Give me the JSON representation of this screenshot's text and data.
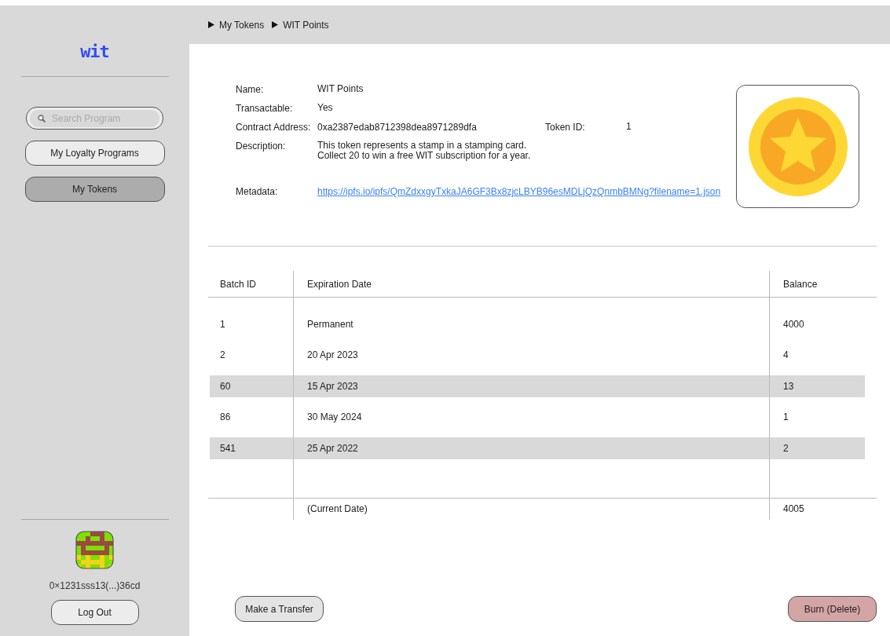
{
  "logo": "wit",
  "breadcrumb": [
    "My Tokens",
    "WIT Points"
  ],
  "sidebar": {
    "search": {
      "placeholder": "Search Program"
    },
    "items": [
      {
        "label": "My Loyalty Programs",
        "selected": false
      },
      {
        "label": "My Tokens",
        "selected": true
      }
    ],
    "account": {
      "address": "0×1231sss13(...)36cd",
      "logout": "Log Out"
    }
  },
  "token": {
    "fields": [
      {
        "label": "Name:",
        "value": "WIT Points"
      },
      {
        "label": "Transactable:",
        "value": "Yes"
      },
      {
        "label": "Contract Address:",
        "value": "0xa2387edab8712398dea8971289dfa",
        "extra_label": "Token ID:",
        "extra_value": "1"
      },
      {
        "label": "Description:",
        "value": "This token represents a stamp in a stamping card.\nCollect 20 to win a free WIT subscription for a year."
      }
    ],
    "metadata": {
      "label": "Metadata:",
      "link": "https://ipfs.io/ipfs/QmZdxxgyTxkaJA6GF3Bx8zjcLBYB96esMDLjQzQnmbBMNg?filename=1.json"
    }
  },
  "table": {
    "columns": [
      "Batch ID",
      "Expiration Date",
      "Balance"
    ],
    "rows": [
      {
        "cells": [
          "1",
          "Permanent",
          "4000"
        ],
        "highlighted": false
      },
      {
        "cells": [
          "2",
          "20 Apr 2023",
          "4"
        ],
        "highlighted": false
      },
      {
        "cells": [
          "60",
          "15 Apr 2023",
          "13"
        ],
        "highlighted": true
      },
      {
        "cells": [
          "86",
          "30 May 2024",
          "1"
        ],
        "highlighted": false
      },
      {
        "cells": [
          "541",
          "25 Apr 2022",
          "2"
        ],
        "highlighted": true
      }
    ],
    "footer": [
      "(Current Date)",
      "4005"
    ]
  },
  "buttons": [
    {
      "label": "Make a Transfer",
      "kind": "neutral"
    },
    {
      "label": "Burn (Delete)",
      "kind": "danger"
    }
  ]
}
